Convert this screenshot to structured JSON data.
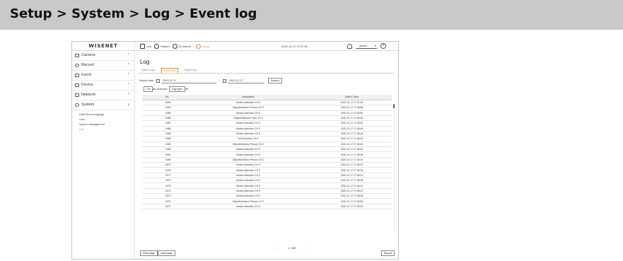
{
  "banner": {
    "title": "Setup > System > Log > Event log"
  },
  "topbar": {
    "logo": "WISENET",
    "menu": [
      {
        "label": "Live",
        "icon": "monitor-icon"
      },
      {
        "label": "Search",
        "icon": "search-icon"
      },
      {
        "label": "AI search",
        "icon": "ai-search-icon"
      },
      {
        "label": "Setup",
        "icon": "gear-icon",
        "active": true
      }
    ],
    "datetime": "2020-12-17 17:37:02",
    "user": "admin",
    "help": "?"
  },
  "sidebar": {
    "items": [
      {
        "label": "Camera",
        "chevron": "^"
      },
      {
        "label": "Record",
        "chevron": "^"
      },
      {
        "label": "Event",
        "chevron": "^"
      },
      {
        "label": "Device",
        "chevron": "^"
      },
      {
        "label": "Network",
        "chevron": "^"
      },
      {
        "label": "System",
        "chevron": "v"
      }
    ],
    "sub_items": [
      "Date/Time/Language",
      "User",
      "System management",
      "Log"
    ]
  },
  "page": {
    "title": "Log",
    "tabs": [
      "System log",
      "Event log",
      "Export log"
    ],
    "search_label": "Search date",
    "date_from": "2020-12-17",
    "date_to": "2020-12-17",
    "tilde": "~",
    "search_button": "Search",
    "ch_button": "CH",
    "all_channels": "All channels",
    "log_type_button": "Log type",
    "log_type_value": "All"
  },
  "table": {
    "columns": [
      "No.",
      "Description",
      "Date & Time"
    ],
    "rows": [
      [
        "0091",
        "Motion detection CH 5",
        "2020-12-17 17:37:00"
      ],
      [
        "0090",
        "ObjectDetection Person CH 2",
        "2020-12-17 17:36:58"
      ],
      [
        "0089",
        "Motion detection CH 5",
        "2020-12-17 17:36:56"
      ],
      [
        "0088",
        "ObjectDetection Face CH 5",
        "2020-12-17 17:36:55"
      ],
      [
        "0087",
        "Motion detection CH 5",
        "2020-12-17 17:36:52"
      ],
      [
        "0086",
        "Motion detection CH 5",
        "2020-12-17 17:36:48"
      ],
      [
        "0085",
        "Motion detection CH 5",
        "2020-12-17 17:36:44"
      ],
      [
        "0084",
        "IVA (Intrusion) CH 2",
        "2020-12-17 17:36:44"
      ],
      [
        "0083",
        "ObjectDetection Person CH 2",
        "2020-12-17 17:36:40"
      ],
      [
        "0082",
        "Motion detection CH 5",
        "2020-12-17 17:36:40"
      ],
      [
        "0081",
        "Motion detection CH 5",
        "2020-12-17 17:36:36"
      ],
      [
        "0080",
        "ObjectDetection Person CH 2",
        "2020-12-17 17:36:32"
      ],
      [
        "0079",
        "Motion detection CH 5",
        "2020-12-17 17:36:32"
      ],
      [
        "0078",
        "Motion detection CH 5",
        "2020-12-17 17:36:28"
      ],
      [
        "0077",
        "Motion detection CH 5",
        "2020-12-17 17:36:22"
      ],
      [
        "0076",
        "Motion detection CH 5",
        "2020-12-17 17:36:18"
      ],
      [
        "0075",
        "Motion detection CH 5",
        "2020-12-17 17:36:14"
      ],
      [
        "0074",
        "Motion detection CH 5",
        "2020-12-17 17:36:10"
      ],
      [
        "0073",
        "Motion detection CH 5",
        "2020-12-17 17:36:08"
      ],
      [
        "0072",
        "ObjectDetection Person CH 2",
        "2020-12-17 17:36:06"
      ],
      [
        "0071",
        "Motion detection CH 5",
        "2020-12-17 17:36:02"
      ]
    ]
  },
  "pager": {
    "prev": "<",
    "text": "1 / 385",
    "next": ">"
  },
  "footer": {
    "first_page": "First page",
    "last_page": "Last page",
    "export": "Export"
  },
  "colors": {
    "accent": "#e8893a",
    "banner": "#c9c9c9"
  }
}
